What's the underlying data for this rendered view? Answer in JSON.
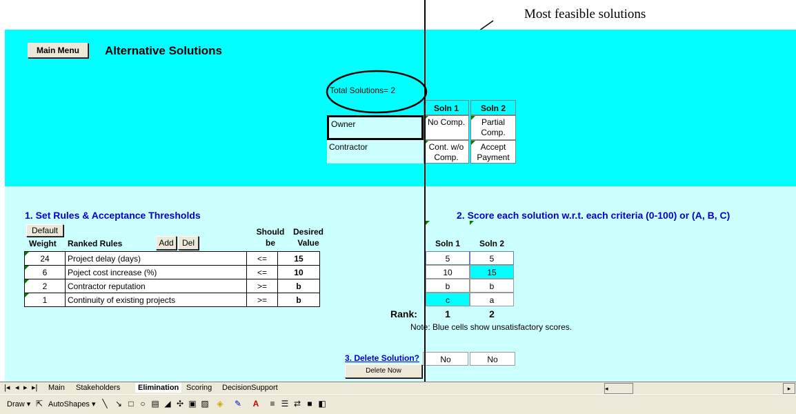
{
  "annotation": {
    "text": "Most feasible solutions"
  },
  "header": {
    "main_menu_label": "Main Menu",
    "title": "Alternative Solutions"
  },
  "summary": {
    "total_solutions": "Total Solutions= 2"
  },
  "solutions_table": {
    "columns": [
      "Soln 1",
      "Soln 2"
    ],
    "rows": [
      {
        "label": "Owner",
        "values": [
          "No Comp.",
          "Partial Comp."
        ]
      },
      {
        "label": "Contractor",
        "values": [
          "Cont. w/o Comp.",
          "Accept Payment"
        ]
      }
    ]
  },
  "rules_section": {
    "heading": "1. Set Rules & Acceptance Thresholds",
    "default_label": "Default",
    "weight_header": "Weight",
    "ranked_rules_header": "Ranked Rules",
    "add_label": "Add",
    "del_label": "Del",
    "should_be_header": "Should be",
    "desired_value_header": "Desired Value",
    "rows": [
      {
        "weight": "24",
        "rule": "Project delay (days)",
        "should": "<=",
        "desired": "15"
      },
      {
        "weight": "6",
        "rule": "Poject cost increase (%)",
        "should": "<=",
        "desired": "10"
      },
      {
        "weight": "2",
        "rule": "Contractor reputation",
        "should": ">=",
        "desired": "b"
      },
      {
        "weight": "1",
        "rule": "Continuity of existing projects",
        "should": ">=",
        "desired": "b"
      }
    ]
  },
  "score_section": {
    "heading": "2. Score each solution w.r.t. each criteria (0-100) or (A, B, C)",
    "columns": [
      "Soln 1",
      "Soln 2"
    ],
    "rows": [
      [
        "5",
        "5"
      ],
      [
        "10",
        "15"
      ],
      [
        "b",
        "b"
      ],
      [
        "c",
        "a"
      ]
    ],
    "rank_label": "Rank:",
    "ranks": [
      "1",
      "2"
    ],
    "note": "Note: Blue cells show unsatisfactory scores.",
    "highlight_color": "#00ffff"
  },
  "delete_section": {
    "heading": "3. Delete Solution?",
    "values": [
      "No",
      "No"
    ],
    "delete_now_label": "Delete Now"
  },
  "sheet_tabs": [
    "Main",
    "Stakeholders",
    "Elimination",
    "Scoring",
    "DecisionSupport"
  ],
  "active_tab": "Elimination",
  "drawing_toolbar": {
    "draw_label": "Draw",
    "autoshapes_label": "AutoShapes"
  },
  "colors": {
    "top_panel": "#00ffff",
    "bottom_panel": "#ccffff",
    "heading_blue": "#0000cc"
  }
}
